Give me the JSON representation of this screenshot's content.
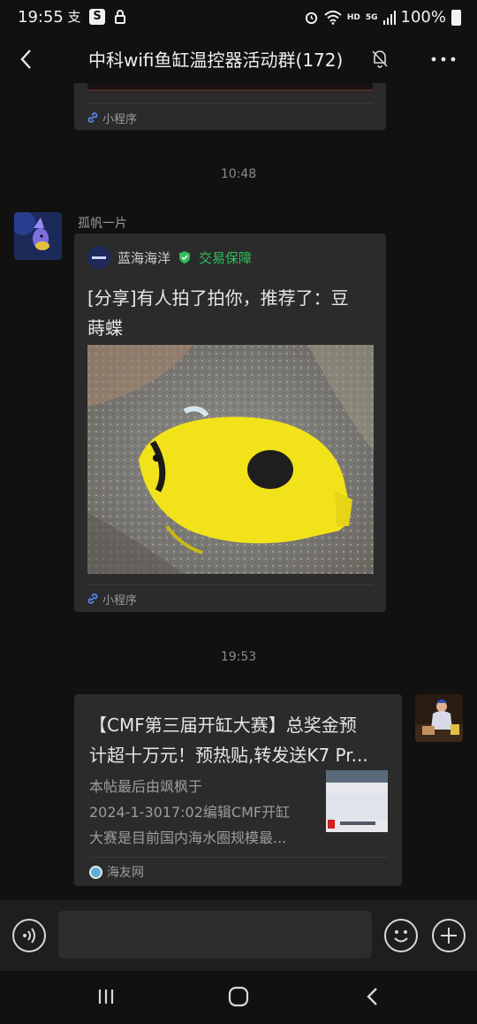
{
  "status_bar": {
    "time": "19:55",
    "battery": "100%",
    "network": "HD",
    "signal": "5G",
    "left_icons": [
      "alipay-icon",
      "s-app-icon",
      "lock-icon"
    ],
    "right_icons": [
      "alarm-icon",
      "wifi-icon",
      "signal-icon",
      "battery-icon"
    ]
  },
  "header": {
    "title": "中科wifi鱼缸温控器活动群(172)",
    "icons": [
      "back-icon",
      "mute-bell-icon",
      "more-icon"
    ]
  },
  "messages": {
    "first_partial": {
      "footer_label": "小程序"
    },
    "time_1": "10:48",
    "share_card": {
      "sender": "孤帆一片",
      "shop_name": "蓝海海洋",
      "guarantee": "交易保障",
      "title_line1": "[分享]有人拍了拍你，推荐了：豆",
      "title_line2": "蒔蝶",
      "footer_label": "小程序"
    },
    "time_2": "19:53",
    "article_card": {
      "title_line1": "【CMF第三届开缸大赛】总奖金预",
      "title_line2": "计超十万元！预热贴,转发送K7 Pr...",
      "desc_line1": "本帖最后由飒枫于",
      "desc_line2": "2024-1-3017:02编辑CMF开缸",
      "desc_line3": "大赛是目前国内海水圈规模最...",
      "source": "海友网"
    }
  },
  "colors": {
    "background": "#111111",
    "bubble": "#2b2b2b",
    "guarantee_green": "#2fbf5d",
    "fish_yellow": "#f2e21a"
  },
  "nav": {
    "icons": [
      "recents-icon",
      "home-icon",
      "back-nav-icon"
    ]
  }
}
